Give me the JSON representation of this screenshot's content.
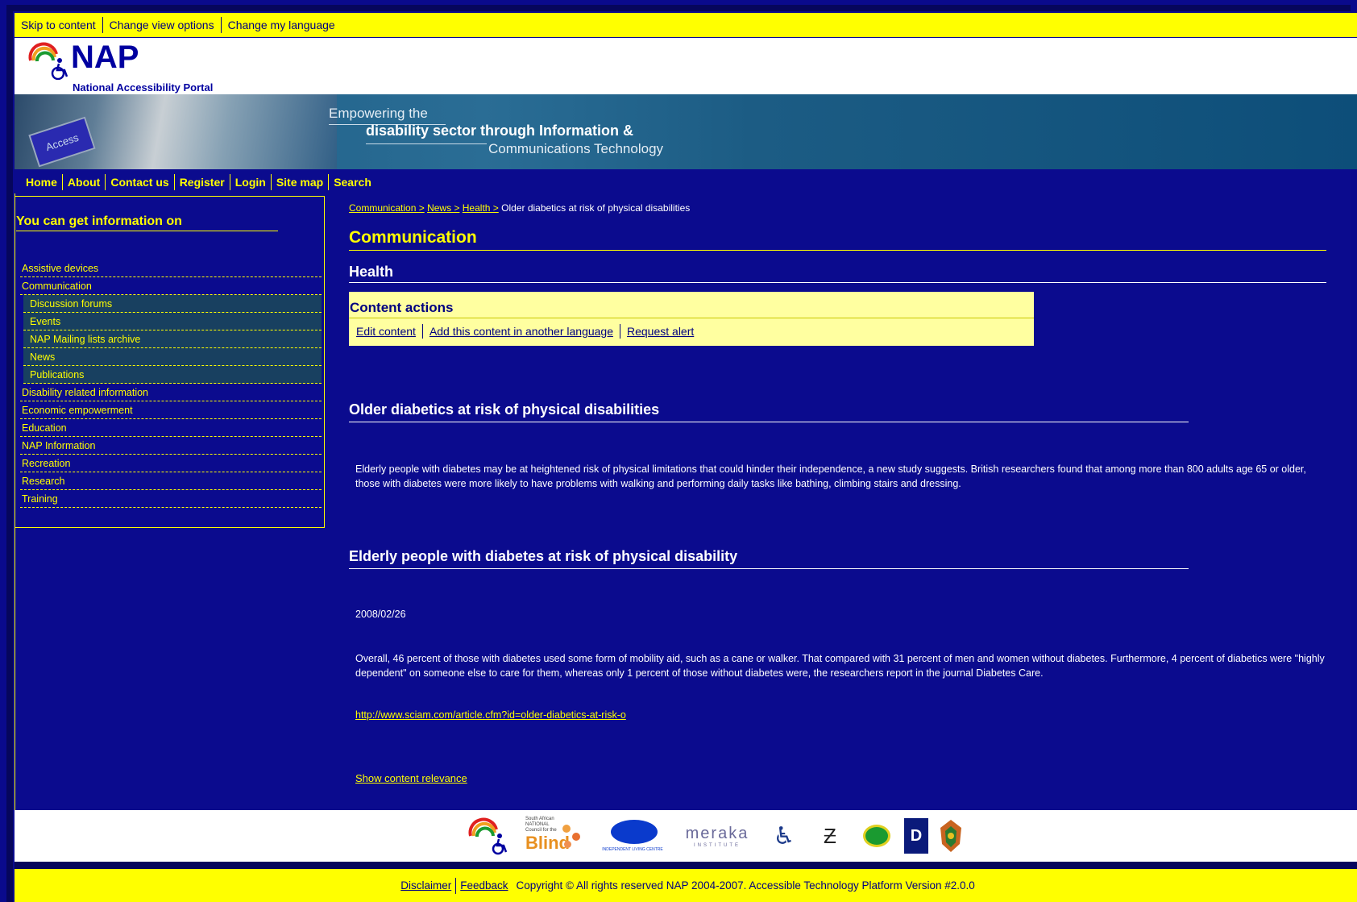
{
  "top_links": [
    "Skip to content",
    "Change view options",
    "Change my language"
  ],
  "logo": {
    "name": "NAP",
    "subtitle": "National Accessibility Portal",
    "mark_text": "NATIONAL ACCESSIBILITY PORTAL"
  },
  "banner": {
    "line1": "Empowering the",
    "line2": "disability sector through Information &",
    "line3": "Communications Technology",
    "key_label": "Access"
  },
  "nav": [
    "Home",
    "About",
    "Contact us",
    "Register",
    "Login",
    "Site map",
    "Search"
  ],
  "sidebar": {
    "heading": "You can get information on",
    "items": [
      "Assistive devices",
      "Communication",
      "Disability related information",
      "Economic empowerment",
      "Education",
      "NAP Information",
      "Recreation",
      "Research",
      "Training"
    ],
    "subitems": [
      "Discussion forums",
      "Events",
      "NAP Mailing lists archive",
      "News",
      "Publications"
    ]
  },
  "breadcrumb": {
    "links": [
      "Communication >",
      "News >",
      "Health >"
    ],
    "current": "Older diabetics at risk of physical disabilities"
  },
  "main": {
    "section_title": "Communication",
    "subsection_title": "Health",
    "content_actions": {
      "title": "Content actions",
      "links": [
        "Edit content",
        "Add this content in another language",
        "Request alert"
      ]
    },
    "article1": {
      "title": "Older diabetics at risk of physical disabilities",
      "body": "Elderly people with diabetes may be at heightened risk of physical limitations that could hinder their independence, a new study suggests. British researchers found that among more than 800 adults age 65 or older, those with diabetes were more likely to have problems with walking and performing daily tasks like bathing, climbing stairs and dressing."
    },
    "article2": {
      "title": "Elderly people with diabetes at risk of physical disability",
      "date": "2008/02/26",
      "body": "Overall, 46 percent of those with diabetes used some form of mobility aid, such as a cane or walker. That compared with 31 percent of men and women without diabetes. Furthermore, 4 percent of diabetics were \"highly dependent\" on someone else to care for them, whereas only 1 percent of those without diabetes were, the researchers report in the journal Diabetes Care.",
      "link": "http://www.sciam.com/article.cfm?id=older-diabetics-at-risk-o"
    },
    "show_relevance": "Show content relevance"
  },
  "partners": {
    "blind_top": "South African NATIONAL Council for the",
    "blind_main": "Blind",
    "ilc": "INDEPENDENT LIVING CENTRE",
    "meraka": "meraka",
    "meraka_sub": "INSTITUTE"
  },
  "footer": {
    "links": [
      "Disclaimer",
      "Feedback"
    ],
    "copyright": "Copyright © All rights reserved NAP 2004-2007. Accessible Technology Platform Version #2.0.0"
  },
  "colors": {
    "background": "#0b0b8e",
    "accent": "#ffff00",
    "action_panel": "#ffffa0"
  }
}
